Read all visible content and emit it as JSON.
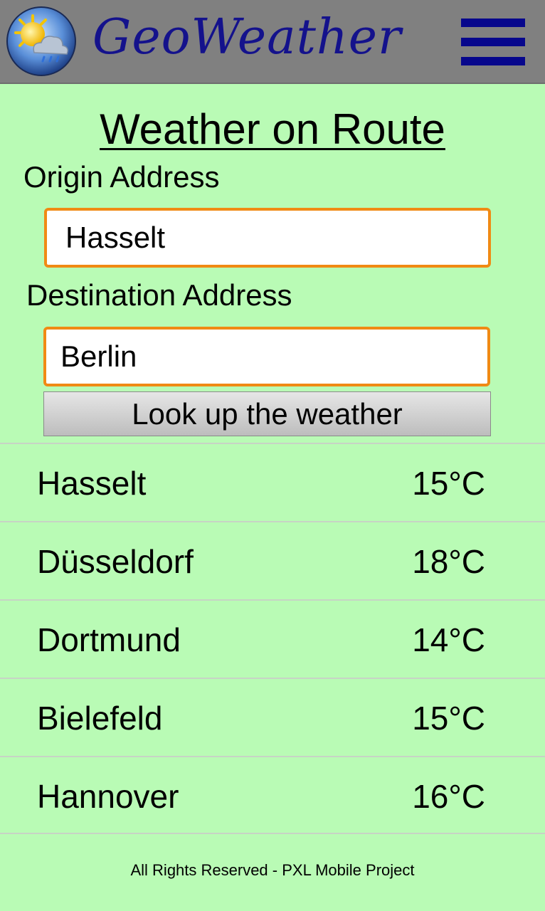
{
  "header": {
    "app_name": "GeoWeather",
    "logo_icon": "sun-cloud-rain-icon",
    "menu_icon": "hamburger-menu-icon",
    "menu_color": "#07078c",
    "title_color": "#14128c",
    "background": "#808080"
  },
  "main": {
    "title": "Weather on Route",
    "origin_label": "Origin Address",
    "origin_value": "Hasselt",
    "destination_label": "Destination Address",
    "destination_value": "Berlin",
    "lookup_button": "Look up the weather",
    "input_border_color": "#f08a14",
    "background": "#b9fbb5"
  },
  "results": [
    {
      "city": "Hasselt",
      "temp": "15°C"
    },
    {
      "city": "Düsseldorf",
      "temp": "18°C"
    },
    {
      "city": "Dortmund",
      "temp": "14°C"
    },
    {
      "city": "Bielefeld",
      "temp": "15°C"
    },
    {
      "city": "Hannover",
      "temp": "16°C"
    }
  ],
  "footer": {
    "text": "All Rights Reserved - PXL Mobile Project"
  }
}
